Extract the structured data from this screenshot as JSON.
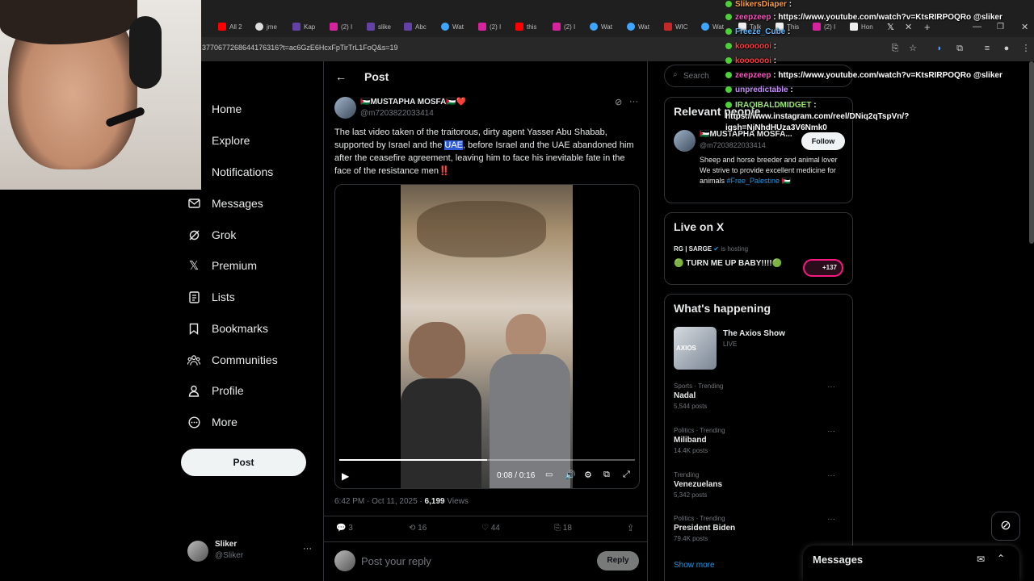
{
  "browser": {
    "tabs": [
      "All 2",
      "jme",
      "Kap",
      "(2) I",
      "slike",
      "Abc",
      "Wat",
      "(2) I",
      "this",
      "(2) I",
      "Wat",
      "Wat",
      "WIC",
      "Wat",
      "Talk",
      "This",
      "(2) I",
      "Hon"
    ],
    "url": "3770677268644176316?t=ac6GzE6HcxFpTirTrL1FoQ&s=19"
  },
  "nav": {
    "items": [
      "Home",
      "Explore",
      "Notifications",
      "Messages",
      "Grok",
      "Premium",
      "Lists",
      "Bookmarks",
      "Communities",
      "Profile",
      "More"
    ],
    "post_label": "Post",
    "account_name": "Sliker",
    "account_handle": "@Sliker"
  },
  "post": {
    "header_title": "Post",
    "author_name": "🇵🇸MUSTAPHA MOSFA🇵🇸❤️",
    "author_handle": "@m7203822033414",
    "text_part1": "The last video taken of the traitorous, dirty agent Yasser Abu Shabab, supported by Israel and the ",
    "text_highlight": "UAE",
    "text_part2": ", before Israel and the UAE abandoned him after the ceasefire agreement, leaving him to face his inevitable fate in the face of the resistance men",
    "text_emoji": "‼️",
    "video_time": "0:08 / 0:16",
    "video_progress": 0.5,
    "timestamp": "6:42 PM · Oct 11, 2025 · ",
    "views_count": "6,199",
    "views_label": "Views",
    "replies": "3",
    "reposts": "16",
    "likes": "44",
    "bookmarks": "18",
    "reply_placeholder": "Post your reply",
    "reply_button": "Reply"
  },
  "sidebar": {
    "search_placeholder": "Search",
    "relevant_title": "Relevant people",
    "person_name": "🇵🇸MUSTAPHA MOSFA...",
    "person_handle": "@m7203822033414",
    "follow_label": "Follow",
    "person_bio": "Sheep and horse breeder and animal lover We strive to provide excellent medicine for animals ",
    "person_bio_tag": "#Free_Palestine",
    "person_bio_flag": "🇵🇸",
    "live_title": "Live on X",
    "live_host": "RG | SARGE",
    "live_hosting_label": "is hosting",
    "live_space_title": "🟢 TURN ME UP BABY!!!!🟢",
    "live_listeners": "+137",
    "happening_title": "What's happening",
    "featured_title": "The Axios Show",
    "featured_status": "LIVE",
    "featured_thumb_label": "AXIOS",
    "trends": [
      {
        "category": "Sports · Trending",
        "name": "Nadal",
        "count": "5,544 posts"
      },
      {
        "category": "Politics · Trending",
        "name": "Miliband",
        "count": "14.4K posts"
      },
      {
        "category": "Trending",
        "name": "Venezuelans",
        "count": "5,342 posts"
      },
      {
        "category": "Politics · Trending",
        "name": "President Biden",
        "count": "79.4K posts"
      }
    ],
    "show_more": "Show more",
    "messages_label": "Messages"
  },
  "chat": [
    {
      "user": "SlikersDiaper",
      "msg": "",
      "color": "#ff9d3c"
    },
    {
      "user": "zeepzeep",
      "msg": "https://www.youtube.com/watch?v=KtsRIRPOQRo @sliker",
      "color": "#ff4fc1"
    },
    {
      "user": "Freeze_Cube",
      "msg": "",
      "color": "#5fb8ff"
    },
    {
      "user": "kooooooi",
      "msg": "",
      "color": "#ff3b3b"
    },
    {
      "user": "kooooooi",
      "msg": "",
      "color": "#ff3b3b"
    },
    {
      "user": "zeepzeep",
      "msg": "https://www.youtube.com/watch?v=KtsRIRPOQRo @sliker",
      "color": "#ff4fc1"
    },
    {
      "user": "unpredictable",
      "msg": "",
      "color": "#c58cff"
    },
    {
      "user": "IRAQIBALDMIDGET",
      "msg": "https://www.instagram.com/reel/DNiq2qTspVn/?igsh=NjNhdHUza3V6Nmk0",
      "color": "#9be37a"
    }
  ]
}
